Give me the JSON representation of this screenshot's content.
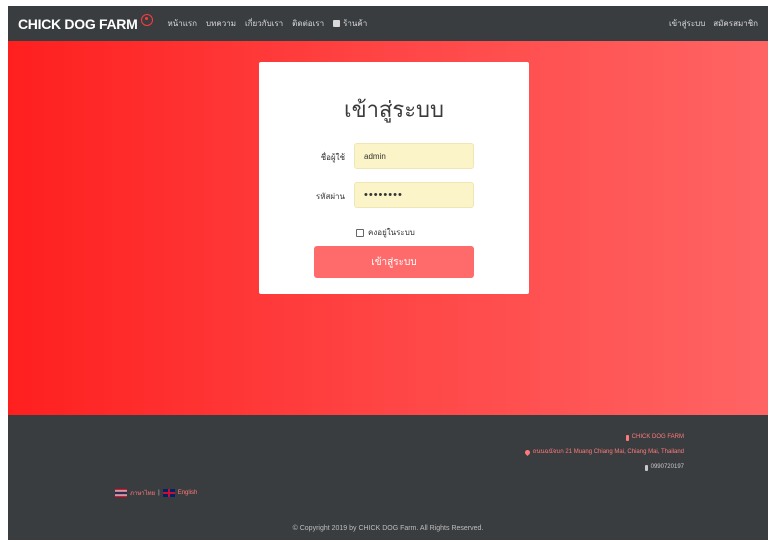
{
  "navbar": {
    "brand": "CHICK DOG FARM",
    "links": [
      "หน้าแรก",
      "บทความ",
      "เกี่ยวกับเรา",
      "ติดต่อเรา",
      "ร้านค้า"
    ],
    "right_links": [
      "เข้าสู่ระบบ",
      "สมัครสมาชิก"
    ]
  },
  "login": {
    "title": "เข้าสู่ระบบ",
    "username_label": "ชื่อผู้ใช้",
    "username_value": "admin",
    "password_label": "รหัสผ่าน",
    "password_value": "admin123",
    "remember_label": "คงอยู่ในระบบ",
    "submit_label": "เข้าสู่ระบบ"
  },
  "footer": {
    "facebook": "CHICK DOG FARM",
    "address": "ถนนฉนัจบก 21 Muang Chiang Mai, Chiang Mai, Thailand",
    "phone": "0990720197",
    "lang_thai": "ภาษาไทย",
    "lang_sep": "|",
    "lang_english": "English",
    "copyright": "© Copyright 2019 by CHICK DOG Farm. All Rights Reserved."
  },
  "colors": {
    "navbar_bg": "#3a3d40",
    "hero_gradient_start": "#ff1f1f",
    "hero_gradient_end": "#ff6464",
    "button_bg": "#ff6b6b",
    "input_bg": "#fbf4c8",
    "footer_link": "#ff7b7b"
  }
}
